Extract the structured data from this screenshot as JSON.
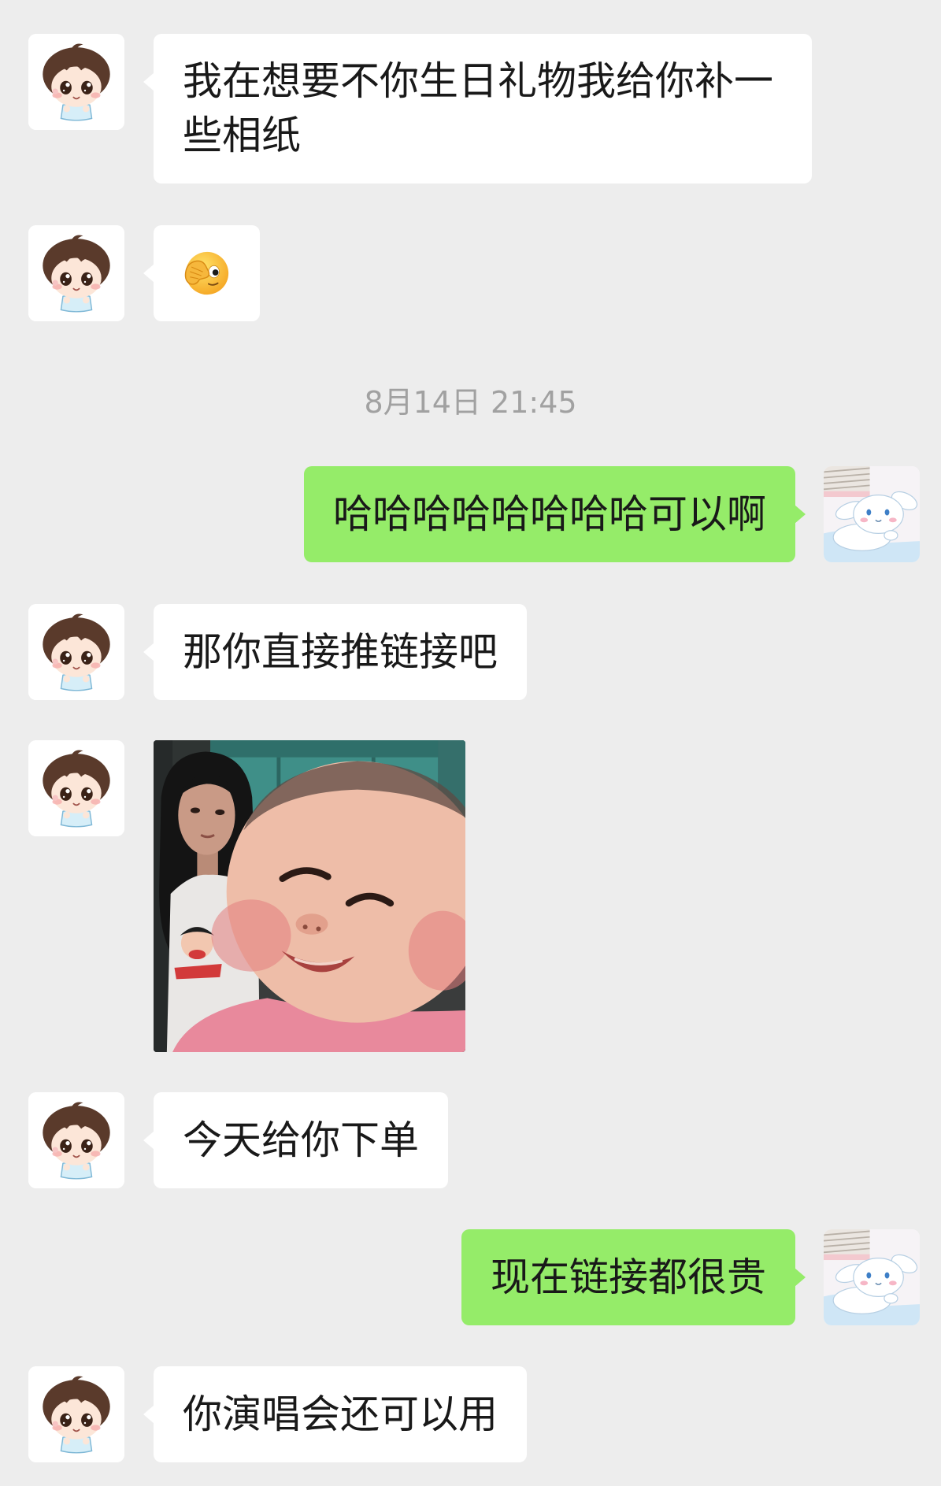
{
  "colors": {
    "background": "#ededed",
    "incoming_bubble": "#ffffff",
    "outgoing_bubble": "#95ec69",
    "message_text": "#191919",
    "timestamp_text": "#a1a1a1"
  },
  "contact": {
    "avatar_icon": "cartoon-boy-avatar-icon"
  },
  "me": {
    "avatar_icon": "white-puppy-avatar-icon"
  },
  "messages": [
    {
      "outgoing": false,
      "text": "我在想要不你生日礼物我给你补一些相纸"
    },
    {
      "outgoing": false,
      "emoji_icon": "peeking-face-icon"
    },
    {
      "timestamp": "8月14日 21:45"
    },
    {
      "outgoing": true,
      "text": "哈哈哈哈哈哈哈哈可以啊"
    },
    {
      "outgoing": false,
      "text": "那你直接推链接吧"
    },
    {
      "outgoing": false,
      "photo": true
    },
    {
      "outgoing": false,
      "text": "今天给你下单"
    },
    {
      "outgoing": true,
      "text": "现在链接都很贵"
    },
    {
      "outgoing": false,
      "text": "你演唱会还可以用"
    }
  ]
}
